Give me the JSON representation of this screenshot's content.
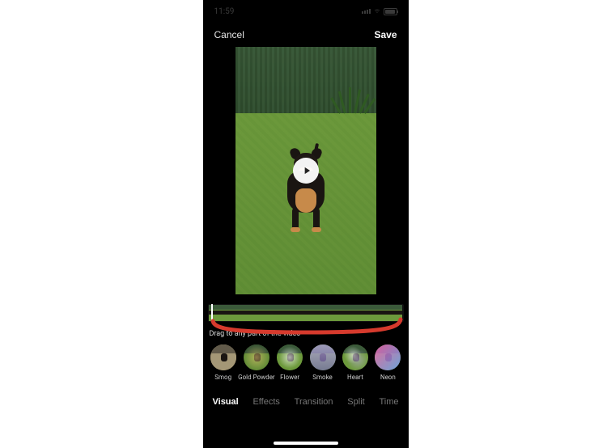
{
  "statusbar": {
    "time": "11:59"
  },
  "header": {
    "cancel": "Cancel",
    "save": "Save"
  },
  "hint": "Drag to any part of the video",
  "filters": [
    {
      "id": "smog",
      "label": "Smog"
    },
    {
      "id": "gold",
      "label": "Gold Powder"
    },
    {
      "id": "flower",
      "label": "Flower"
    },
    {
      "id": "smoke",
      "label": "Smoke"
    },
    {
      "id": "heart",
      "label": "Heart"
    },
    {
      "id": "neon",
      "label": "Neon"
    }
  ],
  "tabs": [
    {
      "id": "visual",
      "label": "Visual",
      "active": true
    },
    {
      "id": "effects",
      "label": "Effects",
      "active": false
    },
    {
      "id": "transition",
      "label": "Transition",
      "active": false
    },
    {
      "id": "split",
      "label": "Split",
      "active": false
    },
    {
      "id": "time",
      "label": "Time",
      "active": false
    }
  ]
}
